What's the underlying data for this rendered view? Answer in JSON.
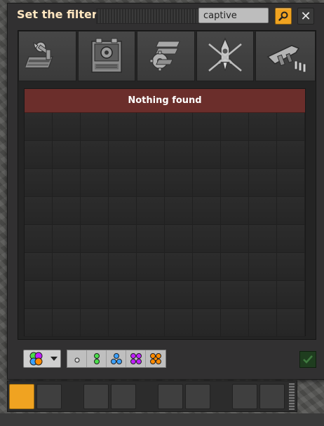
{
  "window": {
    "title": "Set the filter"
  },
  "search": {
    "value": "captive"
  },
  "tabs": [
    {
      "icon": "logistics-icon"
    },
    {
      "icon": "production-icon"
    },
    {
      "icon": "intermediate-products-icon"
    },
    {
      "icon": "space-icon"
    },
    {
      "icon": "combat-icon"
    }
  ],
  "results": {
    "message": "Nothing found"
  },
  "quality": {
    "selected_icon": "any-quality-icon",
    "levels": [
      "normal",
      "uncommon",
      "rare",
      "epic",
      "legendary"
    ],
    "colors": {
      "normal": "#d8d8d8",
      "uncommon": "#4ade4a",
      "rare": "#3aa0ff",
      "epic": "#c020ff",
      "legendary": "#ff8a00"
    }
  },
  "colors": {
    "accent": "#f0a321",
    "title": "#ffe6c0",
    "error_banner": "#6b2e2b",
    "confirm": "#1f3d1f"
  }
}
